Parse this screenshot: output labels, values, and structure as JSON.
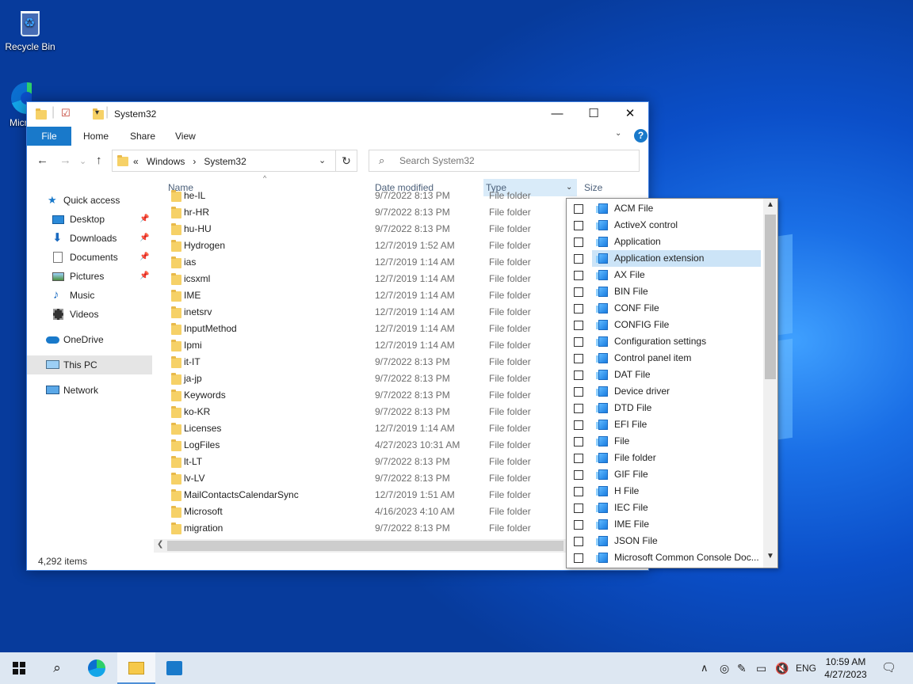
{
  "desktop": {
    "icons": [
      {
        "label": "Recycle Bin"
      },
      {
        "label": "Microsoft Edge"
      }
    ]
  },
  "window": {
    "title": "System32",
    "controls": {
      "minimize": "—",
      "maximize": "☐",
      "close": "✕"
    },
    "ribbon": {
      "file": "File",
      "tabs": [
        "Home",
        "Share",
        "View"
      ],
      "help": "?"
    },
    "nav": {
      "back": "←",
      "forward": "→",
      "up": "↑",
      "recent": "⌄"
    },
    "address": {
      "prefix": "«",
      "crumbs": [
        "Windows",
        "System32"
      ],
      "sep": "›"
    },
    "search": {
      "placeholder": "Search System32"
    },
    "navpane": [
      {
        "label": "Quick access",
        "icon": "star-icon"
      },
      {
        "label": "Desktop",
        "icon": "desktop-icon",
        "pinned": true
      },
      {
        "label": "Downloads",
        "icon": "downloads-icon",
        "pinned": true
      },
      {
        "label": "Documents",
        "icon": "documents-icon",
        "pinned": true
      },
      {
        "label": "Pictures",
        "icon": "pictures-icon",
        "pinned": true
      },
      {
        "label": "Music",
        "icon": "music-icon"
      },
      {
        "label": "Videos",
        "icon": "videos-icon"
      },
      {
        "label": "OneDrive",
        "icon": "cloud-icon"
      },
      {
        "label": "This PC",
        "icon": "computer-icon",
        "selected": true
      },
      {
        "label": "Network",
        "icon": "network-icon"
      }
    ],
    "columns": {
      "name": "Name",
      "date": "Date modified",
      "type": "Type",
      "size": "Size"
    },
    "rows": [
      {
        "name": "he-IL",
        "date": "9/7/2022 8:13 PM",
        "type": "File folder"
      },
      {
        "name": "hr-HR",
        "date": "9/7/2022 8:13 PM",
        "type": "File folder"
      },
      {
        "name": "hu-HU",
        "date": "9/7/2022 8:13 PM",
        "type": "File folder"
      },
      {
        "name": "Hydrogen",
        "date": "12/7/2019 1:52 AM",
        "type": "File folder"
      },
      {
        "name": "ias",
        "date": "12/7/2019 1:14 AM",
        "type": "File folder"
      },
      {
        "name": "icsxml",
        "date": "12/7/2019 1:14 AM",
        "type": "File folder"
      },
      {
        "name": "IME",
        "date": "12/7/2019 1:14 AM",
        "type": "File folder"
      },
      {
        "name": "inetsrv",
        "date": "12/7/2019 1:14 AM",
        "type": "File folder"
      },
      {
        "name": "InputMethod",
        "date": "12/7/2019 1:14 AM",
        "type": "File folder"
      },
      {
        "name": "Ipmi",
        "date": "12/7/2019 1:14 AM",
        "type": "File folder"
      },
      {
        "name": "it-IT",
        "date": "9/7/2022 8:13 PM",
        "type": "File folder"
      },
      {
        "name": "ja-jp",
        "date": "9/7/2022 8:13 PM",
        "type": "File folder"
      },
      {
        "name": "Keywords",
        "date": "9/7/2022 8:13 PM",
        "type": "File folder"
      },
      {
        "name": "ko-KR",
        "date": "9/7/2022 8:13 PM",
        "type": "File folder"
      },
      {
        "name": "Licenses",
        "date": "12/7/2019 1:14 AM",
        "type": "File folder"
      },
      {
        "name": "LogFiles",
        "date": "4/27/2023 10:31 AM",
        "type": "File folder"
      },
      {
        "name": "lt-LT",
        "date": "9/7/2022 8:13 PM",
        "type": "File folder"
      },
      {
        "name": "lv-LV",
        "date": "9/7/2022 8:13 PM",
        "type": "File folder"
      },
      {
        "name": "MailContactsCalendarSync",
        "date": "12/7/2019 1:51 AM",
        "type": "File folder"
      },
      {
        "name": "Microsoft",
        "date": "4/16/2023 4:10 AM",
        "type": "File folder"
      },
      {
        "name": "migration",
        "date": "9/7/2022 8:13 PM",
        "type": "File folder"
      }
    ],
    "status": "4,292 items"
  },
  "filter_popup": {
    "options": [
      "ACM File",
      "ActiveX control",
      "Application",
      "Application extension",
      "AX File",
      "BIN File",
      "CONF File",
      "CONFIG File",
      "Configuration settings",
      "Control panel item",
      "DAT File",
      "Device driver",
      "DTD File",
      "EFI File",
      "File",
      "File folder",
      "GIF File",
      "H File",
      "IEC File",
      "IME File",
      "JSON File",
      "Microsoft Common Console Doc..."
    ],
    "highlighted": "Application extension"
  },
  "taskbar": {
    "tray": {
      "chevron": "∧",
      "lang": "ENG",
      "time": "10:59 AM",
      "date": "4/27/2023"
    }
  },
  "colors": {
    "accent": "#1979ca",
    "highlight": "#cce4f7",
    "selected_nav": "#e5e5e5"
  }
}
